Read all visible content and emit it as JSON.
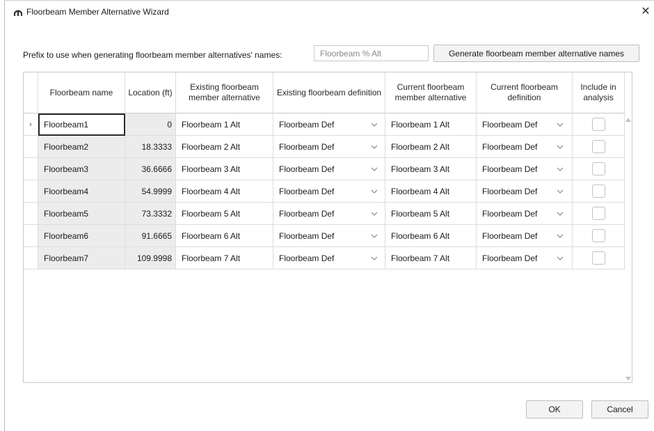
{
  "window": {
    "title": "Floorbeam Member Alternative Wizard",
    "close_glyph": "✕"
  },
  "prefix": {
    "label": "Prefix to use when generating floorbeam member alternatives' names:",
    "placeholder": "Floorbeam % Alt",
    "value": ""
  },
  "generate_button": "Generate floorbeam member alternative names",
  "table": {
    "columns": [
      "Floorbeam name",
      "Location (ft)",
      "Existing floorbeam member alternative",
      "Existing floorbeam definition",
      "Current floorbeam member alternative",
      "Current floorbeam definition",
      "Include in analysis"
    ],
    "current_row_marker": "›",
    "rows": [
      {
        "name": "Floorbeam1",
        "location": "0",
        "existing_alt": "Floorbeam 1 Alt",
        "existing_def": "Floorbeam Def",
        "current_alt": "Floorbeam 1 Alt",
        "current_def": "Floorbeam Def",
        "include": false
      },
      {
        "name": "Floorbeam2",
        "location": "18.3333",
        "existing_alt": "Floorbeam 2 Alt",
        "existing_def": "Floorbeam Def",
        "current_alt": "Floorbeam 2 Alt",
        "current_def": "Floorbeam Def",
        "include": false
      },
      {
        "name": "Floorbeam3",
        "location": "36.6666",
        "existing_alt": "Floorbeam 3 Alt",
        "existing_def": "Floorbeam Def",
        "current_alt": "Floorbeam 3 Alt",
        "current_def": "Floorbeam Def",
        "include": false
      },
      {
        "name": "Floorbeam4",
        "location": "54.9999",
        "existing_alt": "Floorbeam 4 Alt",
        "existing_def": "Floorbeam Def",
        "current_alt": "Floorbeam 4 Alt",
        "current_def": "Floorbeam Def",
        "include": false
      },
      {
        "name": "Floorbeam5",
        "location": "73.3332",
        "existing_alt": "Floorbeam 5 Alt",
        "existing_def": "Floorbeam Def",
        "current_alt": "Floorbeam 5 Alt",
        "current_def": "Floorbeam Def",
        "include": false
      },
      {
        "name": "Floorbeam6",
        "location": "91.6665",
        "existing_alt": "Floorbeam 6 Alt",
        "existing_def": "Floorbeam Def",
        "current_alt": "Floorbeam 6 Alt",
        "current_def": "Floorbeam Def",
        "include": false
      },
      {
        "name": "Floorbeam7",
        "location": "109.9998",
        "existing_alt": "Floorbeam 7 Alt",
        "existing_def": "Floorbeam Def",
        "current_alt": "Floorbeam 7 Alt",
        "current_def": "Floorbeam Def",
        "include": false
      }
    ]
  },
  "buttons": {
    "ok": "OK",
    "cancel": "Cancel"
  },
  "colors": {
    "readonly_cell": "#ececec",
    "border": "#c8c8c8"
  }
}
